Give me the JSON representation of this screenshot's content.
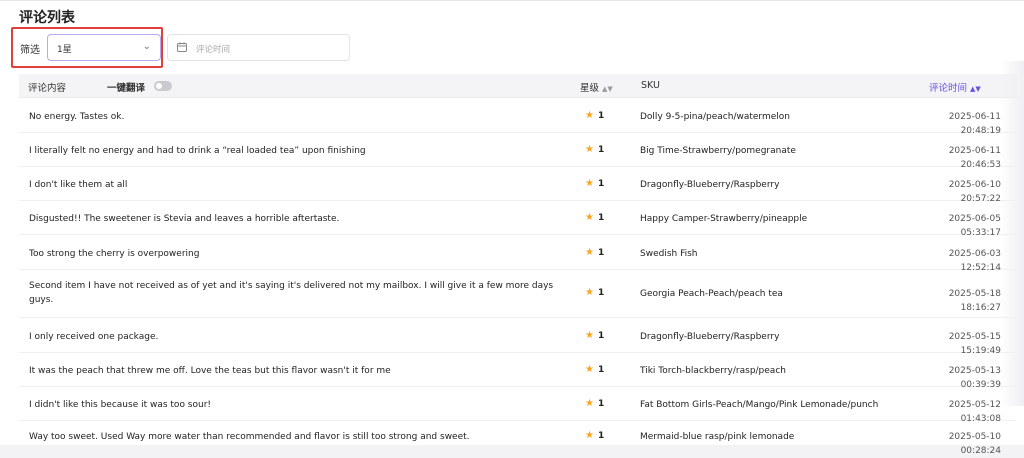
{
  "page": {
    "title": "评论列表"
  },
  "filter": {
    "label": "筛选",
    "select_value": "1星",
    "date_placeholder": "评论时间"
  },
  "table": {
    "columns": {
      "content": "评论内容",
      "translate": "一键翻译",
      "rating": "星级",
      "sku": "SKU",
      "time": "评论时间"
    },
    "rows": [
      {
        "content": "No energy. Tastes ok.",
        "rating": "1",
        "sku": "Dolly 9-5-pina/peach/watermelon",
        "time": "2025-06-11 20:48:19"
      },
      {
        "content": "I literally felt no energy and had to drink a “real loaded tea” upon finishing",
        "rating": "1",
        "sku": "Big Time-Strawberry/pomegranate",
        "time": "2025-06-11 20:46:53"
      },
      {
        "content": "I don't like them at all",
        "rating": "1",
        "sku": "Dragonfly-Blueberry/Raspberry",
        "time": "2025-06-10 20:57:22"
      },
      {
        "content": "Disgusted!! The sweetener is Stevia and leaves a horrible aftertaste.",
        "rating": "1",
        "sku": "Happy Camper-Strawberry/pineapple",
        "time": "2025-06-05 05:33:17"
      },
      {
        "content": "Too strong the cherry is overpowering",
        "rating": "1",
        "sku": "Swedish Fish",
        "time": "2025-06-03 12:52:14"
      },
      {
        "content": "Second item I have not received as of yet and it's saying it's delivered not my mailbox. I will give it a few more days guys.",
        "rating": "1",
        "sku": "Georgia Peach-Peach/peach tea",
        "time": "2025-05-18 18:16:27"
      },
      {
        "content": "I only received one package.",
        "rating": "1",
        "sku": "Dragonfly-Blueberry/Raspberry",
        "time": "2025-05-15 15:19:49"
      },
      {
        "content": "It was the peach that threw me off. Love the teas but this flavor wasn't it for me",
        "rating": "1",
        "sku": "Tiki Torch-blackberry/rasp/peach",
        "time": "2025-05-13 00:39:39"
      },
      {
        "content": "I didn't like this because it was too sour!",
        "rating": "1",
        "sku": "Fat Bottom Girls-Peach/Mango/Pink Lemonade/punch",
        "time": "2025-05-12 01:43:08"
      },
      {
        "content": "Way too sweet. Used Way more water than recommended and flavor is still too strong and sweet.",
        "rating": "1",
        "sku": "Mermaid-blue rasp/pink lemonade",
        "time": "2025-05-10 00:28:24"
      }
    ]
  },
  "colors": {
    "accent": "#6a4fe0",
    "highlight": "#e0403a",
    "star": "#f5a623"
  },
  "icons": {
    "select": "chevron-down-icon",
    "date": "calendar-icon",
    "sort": "sort-icon",
    "rating": "star-icon"
  }
}
